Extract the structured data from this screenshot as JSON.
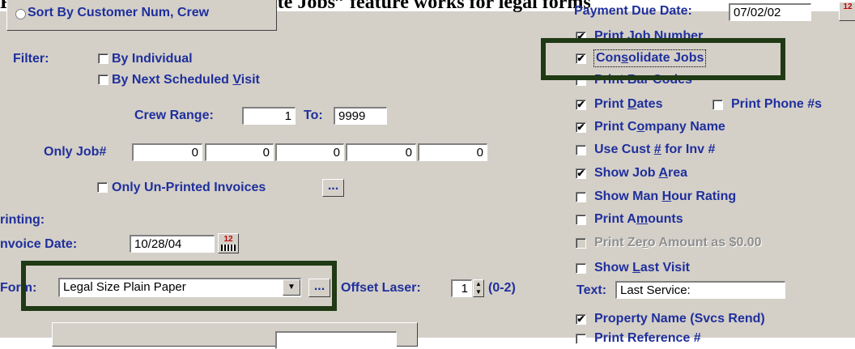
{
  "caption": "Route Sheet Invoice – “Consolidate Jobs” feature works for legal forms",
  "sort_option": "Sort By Customer Num, Crew",
  "filter": {
    "label": "Filter:",
    "by_individual": "By Individual",
    "by_next_visit_pre": "By Next Scheduled ",
    "by_next_visit_u": "V",
    "by_next_visit_post": "isit",
    "crew_range_label": "Crew Range:",
    "crew_from": "1",
    "to_label": "To:",
    "crew_to": "9999",
    "only_job_label": "Only Job#",
    "jobs": [
      "0",
      "0",
      "0",
      "0",
      "0"
    ],
    "only_unprinted": "Only Un-Printed Invoices",
    "ellipsis": "..."
  },
  "printing": {
    "label": "rinting:",
    "invoice_date_label": "nvoice Date:",
    "invoice_date": "10/28/04",
    "calendar_icon_text": "12",
    "form_label": "Fo",
    "form_label_tail": "rm:",
    "form_value": "Legal Size Plain Paper",
    "offset_label": "Offset Laser:",
    "offset_value": "1",
    "offset_range": "(0-2)"
  },
  "right": {
    "payment_due_label": "Payment Due Date:",
    "payment_due_value": "07/02/02",
    "print_job_number": "Print Job Number",
    "consolidate_pre": "Con",
    "consolidate_u": "s",
    "consolidate_post": "olidate Jobs",
    "print_bar_codes": "Print Bar Codes",
    "print_dates_pre": "Print ",
    "print_dates_u": "D",
    "print_dates_post": "ates",
    "print_phone": "Print Phone #s",
    "print_company_pre": "Print C",
    "print_company_u": "o",
    "print_company_post": "mpany Name",
    "use_cust_pre": "Use Cust ",
    "use_cust_u": "#",
    "use_cust_post": " for Inv #",
    "show_job_area_pre": "Show Job ",
    "show_job_area_u": "A",
    "show_job_area_post": "rea",
    "show_man_hour_pre": "Show Man ",
    "show_man_hour_u": "H",
    "show_man_hour_post": "our Rating",
    "print_amounts_pre": "Print A",
    "print_amounts_u": "m",
    "print_amounts_post": "ounts",
    "print_zero_pre": "Print Ze",
    "print_zero_u": "r",
    "print_zero_post": "o Amount as $0.00",
    "show_last_visit_pre": "Show ",
    "show_last_visit_u": "L",
    "show_last_visit_post": "ast Visit",
    "text_label": "Text:",
    "text_value": "Last Service:",
    "property_name": "Property Name (Svcs Rend)",
    "print_reference": "Print Reference #"
  },
  "colors": {
    "label_blue": "#1f2f9c",
    "panel": "#d4d0c8",
    "highlight": "#1f3a14"
  },
  "checked": {
    "by_individual": false,
    "by_next_visit": false,
    "only_unprinted": false,
    "print_job_number": true,
    "consolidate": true,
    "print_bar_codes": false,
    "print_dates": true,
    "print_phone": false,
    "print_company": true,
    "use_cust": false,
    "show_job_area": true,
    "show_man_hour": false,
    "print_amounts": false,
    "print_zero": false,
    "show_last_visit": false,
    "property_name": true,
    "print_reference": false
  }
}
